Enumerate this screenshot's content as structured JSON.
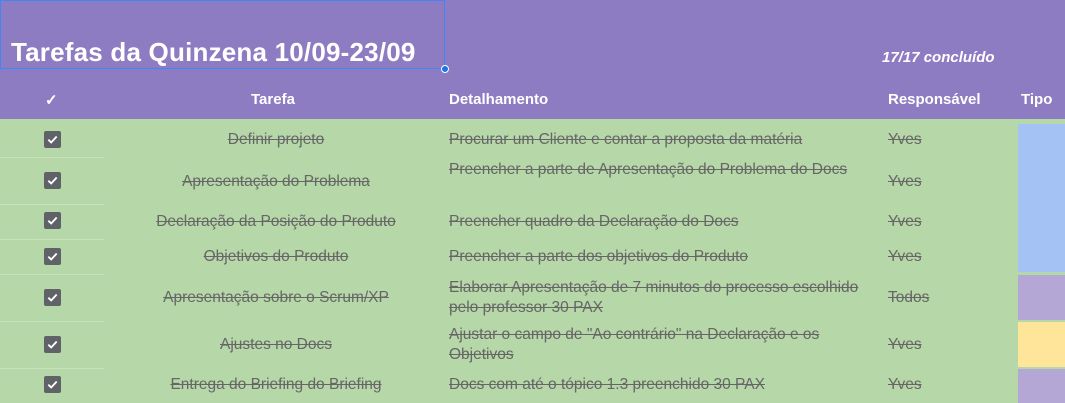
{
  "sheet": {
    "title": "Tarefas da Quinzena 10/09-23/09",
    "progress": "17/17 concluído"
  },
  "headers": {
    "check": "✓",
    "task": "Tarefa",
    "detail": "Detalhamento",
    "owner": "Responsável",
    "type": "Tipo"
  },
  "colors": {
    "header_bg": "#8e7cc3",
    "row_bg": "#b6d7a8",
    "tipo_blue": "#a4c2f4",
    "tipo_purple": "#b4a7d6",
    "tipo_yellow": "#ffe599"
  },
  "rows": [
    {
      "checked": true,
      "task": "Definir projeto",
      "detail": "Procurar um Cliente e contar a proposta da matéria",
      "owner": "Yves"
    },
    {
      "checked": true,
      "task": "Apresentação do Problema",
      "detail": "Preencher a parte de Apresentação do Problema do Docs",
      "owner": "Yves"
    },
    {
      "checked": true,
      "task": "Declaração da Posição do Produto",
      "detail": "Preencher quadro da Declaração do Docs",
      "owner": "Yves"
    },
    {
      "checked": true,
      "task": "Objetivos do Produto",
      "detail": "Preencher a parte dos objetivos do Produto",
      "owner": "Yves"
    },
    {
      "checked": true,
      "task": "Apresentação sobre o Scrum/XP",
      "detail": "Elaborar Apresentação de 7 minutos do processo escolhido pelo professor 30 PAX",
      "owner": "Todos"
    },
    {
      "checked": true,
      "task": "Ajustes no Docs",
      "detail": "Ajustar o campo de \"Ao contrário\" na Declaração e os Objetivos",
      "owner": "Yves"
    },
    {
      "checked": true,
      "task": "Entrega do Briefing do Briefing",
      "detail": "Docs com até o tópico 1.3 preenchido 30 PAX",
      "owner": "Yves"
    }
  ]
}
